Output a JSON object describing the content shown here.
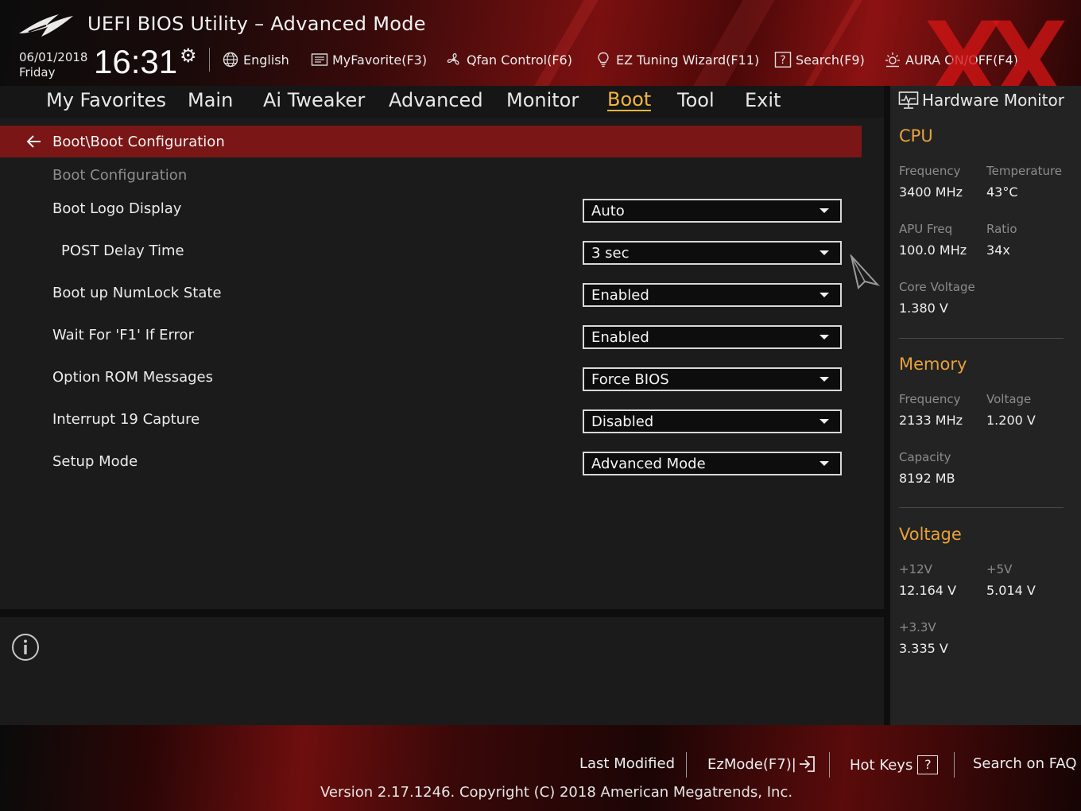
{
  "header": {
    "title": "UEFI BIOS Utility – Advanced Mode",
    "date": "06/01/2018",
    "day": "Friday",
    "time": "16:31",
    "watermark": "XX",
    "tools": [
      {
        "label": "English",
        "icon": "globe-icon"
      },
      {
        "label": "MyFavorite(F3)",
        "icon": "favorite-list-icon"
      },
      {
        "label": "Qfan Control(F6)",
        "icon": "fan-icon"
      },
      {
        "label": "EZ Tuning Wizard(F11)",
        "icon": "lightbulb-icon"
      },
      {
        "label": "Search(F9)",
        "icon": "help-box-icon"
      },
      {
        "label": "AURA ON/OFF(F4)",
        "icon": "aura-light-icon"
      }
    ]
  },
  "menu": {
    "tabs": [
      "My Favorites",
      "Main",
      "Ai Tweaker",
      "Advanced",
      "Monitor",
      "Boot",
      "Tool",
      "Exit"
    ],
    "active": "Boot"
  },
  "main": {
    "breadcrumb": "Boot\\Boot Configuration",
    "section_heading": "Boot Configuration",
    "settings": [
      {
        "label": "Boot Logo Display",
        "value": "Auto"
      },
      {
        "label": "POST Delay Time",
        "value": "3 sec"
      },
      {
        "label": "Boot up NumLock State",
        "value": "Enabled"
      },
      {
        "label": "Wait For 'F1' If Error",
        "value": "Enabled"
      },
      {
        "label": "Option ROM Messages",
        "value": "Force BIOS"
      },
      {
        "label": "Interrupt 19 Capture",
        "value": "Disabled"
      },
      {
        "label": "Setup Mode",
        "value": "Advanced Mode"
      }
    ]
  },
  "hw_monitor": {
    "title": "Hardware Monitor",
    "cpu": {
      "heading": "CPU",
      "frequency_label": "Frequency",
      "frequency": "3400 MHz",
      "temperature_label": "Temperature",
      "temperature": "43°C",
      "apu_freq_label": "APU Freq",
      "apu_freq": "100.0 MHz",
      "ratio_label": "Ratio",
      "ratio": "34x",
      "core_voltage_label": "Core Voltage",
      "core_voltage": "1.380 V"
    },
    "memory": {
      "heading": "Memory",
      "frequency_label": "Frequency",
      "frequency": "2133 MHz",
      "voltage_label": "Voltage",
      "voltage": "1.200 V",
      "capacity_label": "Capacity",
      "capacity": "8192 MB"
    },
    "voltage": {
      "heading": "Voltage",
      "v12_label": "+12V",
      "v12": "12.164 V",
      "v5_label": "+5V",
      "v5": "5.014 V",
      "v33_label": "+3.3V",
      "v33": "3.335 V"
    }
  },
  "footer": {
    "last_modified": "Last Modified",
    "ezmode": "EzMode(F7)|",
    "hot_keys": "Hot Keys",
    "hot_keys_box": "?",
    "search_faq": "Search on FAQ",
    "copyright": "Version 2.17.1246. Copyright (C) 2018 American Megatrends, Inc."
  },
  "colors": {
    "accent": "#f0b63c",
    "hw_heading": "#e8a23a",
    "breadcrumb_bar": "#7a1616"
  }
}
